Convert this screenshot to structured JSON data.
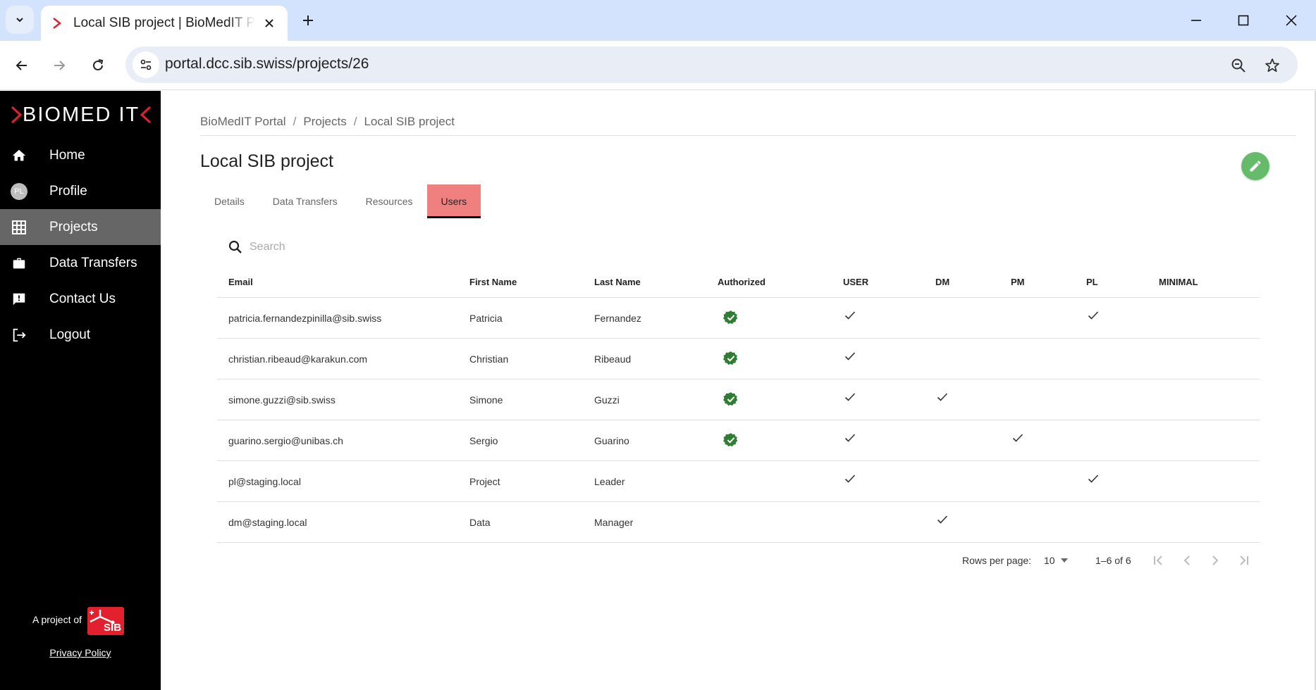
{
  "browser": {
    "tab_title": "Local SIB project | BioMedIT Portal",
    "url": "portal.dcc.sib.swiss/projects/26",
    "icons": {
      "tab_menu": "chevron-down-icon",
      "favicon": "biomedit-chevron-icon",
      "close_tab": "close-icon",
      "new_tab": "plus-icon",
      "minimize": "minimize-icon",
      "maximize": "maximize-icon",
      "close_window": "close-icon",
      "back": "arrow-left-icon",
      "forward": "arrow-right-icon",
      "reload": "reload-icon",
      "site_info": "tune-icon",
      "zoom": "zoom-out-icon",
      "bookmark": "star-icon"
    }
  },
  "sidebar": {
    "logo": "BIOMED IT",
    "items": [
      {
        "label": "Home",
        "icon": "home-icon",
        "active": false
      },
      {
        "label": "Profile",
        "icon": "avatar",
        "avatar_initials": "PL",
        "active": false
      },
      {
        "label": "Projects",
        "icon": "grid-icon",
        "active": true
      },
      {
        "label": "Data Transfers",
        "icon": "briefcase-icon",
        "active": false
      },
      {
        "label": "Contact Us",
        "icon": "feedback-icon",
        "active": false
      },
      {
        "label": "Logout",
        "icon": "logout-icon",
        "active": false
      }
    ],
    "project_of": "A project of",
    "sib_logo_text": "SIB",
    "privacy_policy": "Privacy Policy"
  },
  "main": {
    "breadcrumb": [
      "BioMedIT Portal",
      "Projects",
      "Local SIB project"
    ],
    "breadcrumb_separator": "/",
    "title": "Local SIB project",
    "edit_icon": "pencil-icon",
    "tabs": [
      {
        "label": "Details",
        "active": false
      },
      {
        "label": "Data Transfers",
        "active": false
      },
      {
        "label": "Resources",
        "active": false
      },
      {
        "label": "Users",
        "active": true
      }
    ],
    "search": {
      "placeholder": "Search",
      "value": ""
    },
    "colors": {
      "active_tab": "#f08080",
      "authorized": "#2e7d32",
      "edit_fab": "#66bb6a",
      "sidebar_active": "#666666"
    },
    "table": {
      "columns": [
        "Email",
        "First Name",
        "Last Name",
        "Authorized",
        "USER",
        "DM",
        "PM",
        "PL",
        "MINIMAL"
      ],
      "rows": [
        {
          "email": "patricia.fernandezpinilla@sib.swiss",
          "first": "Patricia",
          "last": "Fernandez",
          "authorized": true,
          "USER": true,
          "DM": false,
          "PM": false,
          "PL": true,
          "MINIMAL": false
        },
        {
          "email": "christian.ribeaud@karakun.com",
          "first": "Christian",
          "last": "Ribeaud",
          "authorized": true,
          "USER": true,
          "DM": false,
          "PM": false,
          "PL": false,
          "MINIMAL": false
        },
        {
          "email": "simone.guzzi@sib.swiss",
          "first": "Simone",
          "last": "Guzzi",
          "authorized": true,
          "USER": true,
          "DM": true,
          "PM": false,
          "PL": false,
          "MINIMAL": false
        },
        {
          "email": "guarino.sergio@unibas.ch",
          "first": "Sergio",
          "last": "Guarino",
          "authorized": true,
          "USER": true,
          "DM": false,
          "PM": true,
          "PL": false,
          "MINIMAL": false
        },
        {
          "email": "pl@staging.local",
          "first": "Project",
          "last": "Leader",
          "authorized": false,
          "USER": true,
          "DM": false,
          "PM": false,
          "PL": true,
          "MINIMAL": false
        },
        {
          "email": "dm@staging.local",
          "first": "Data",
          "last": "Manager",
          "authorized": false,
          "USER": false,
          "DM": true,
          "PM": false,
          "PL": false,
          "MINIMAL": false
        }
      ]
    },
    "pagination": {
      "rows_per_page_label": "Rows per page:",
      "rows_per_page": "10",
      "range": "1–6 of 6",
      "buttons": [
        "first-page-icon",
        "prev-page-icon",
        "next-page-icon",
        "last-page-icon"
      ]
    }
  }
}
